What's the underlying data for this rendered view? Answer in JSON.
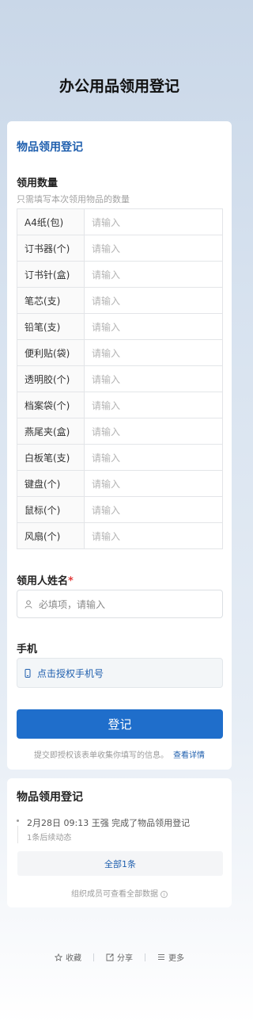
{
  "page": {
    "title": "办公用品领用登记"
  },
  "form": {
    "title": "物品领用登记",
    "quantity": {
      "label": "领用数量",
      "hint": "只需填写本次领用物品的数量",
      "placeholder": "请输入",
      "items": [
        "A4纸(包)",
        "订书器(个)",
        "订书针(盒)",
        "笔芯(支)",
        "铅笔(支)",
        "便利贴(袋)",
        "透明胶(个)",
        "档案袋(个)",
        "燕尾夹(盒)",
        "白板笔(支)",
        "键盘(个)",
        "鼠标(个)",
        "风扇(个)"
      ]
    },
    "name_field": {
      "label": "领用人姓名",
      "required_mark": "*",
      "placeholder": "必填项，请输入"
    },
    "phone_field": {
      "label": "手机",
      "button_label": "点击授权手机号"
    },
    "submit_label": "登记",
    "consent_text": "提交即授权该表单收集你填写的信息。",
    "consent_link": "查看详情"
  },
  "activity": {
    "title": "物品领用登记",
    "feed": [
      {
        "text": "2月28日 09:13  王强 完成了物品领用登记",
        "sub": "1条后续动态"
      }
    ],
    "all_button": "全部1条",
    "note": "组织成员可查看全部数据",
    "note_icon": "i"
  },
  "bottom_bar": {
    "collect": "收藏",
    "share": "分享",
    "more": "更多"
  },
  "colors": {
    "accent": "#1f6ecb",
    "link": "#1f5fae",
    "required": "#e23b3b"
  }
}
